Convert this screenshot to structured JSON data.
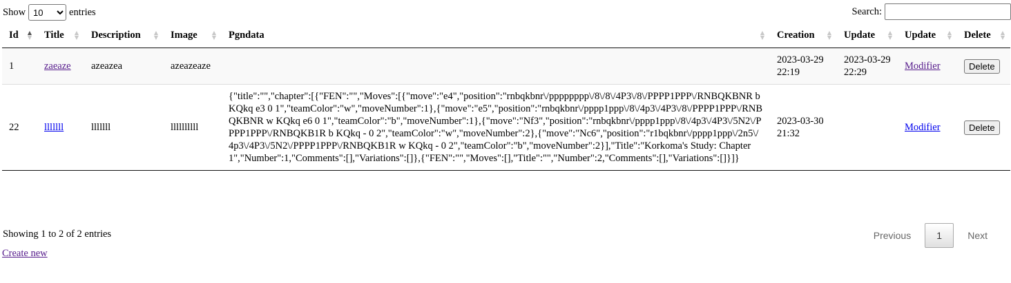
{
  "length": {
    "show": "Show",
    "value": "10",
    "entries": "entries"
  },
  "search": {
    "label": "Search:",
    "value": ""
  },
  "columns": [
    "Id",
    "Title",
    "Description",
    "Image",
    "Pgndata",
    "Creation",
    "Update",
    "Update",
    "Delete"
  ],
  "rows": [
    {
      "id": "1",
      "title": "zaeaze",
      "description": "azeazea",
      "image": "azeazeaze",
      "pgndata": "",
      "creation": "2023-03-29 22:19",
      "update": "2023-03-29 22:29",
      "modify": "Modifier",
      "delete": "Delete"
    },
    {
      "id": "22",
      "title": "lllllll",
      "description": "lllllll",
      "image": "llllllllll",
      "pgndata": "{\"title\":\"\",\"chapter\":[{\"FEN\":\"\",\"Moves\":[{\"move\":\"e4\",\"position\":\"rnbqkbnr\\/pppppppp\\/8\\/8\\/4P3\\/8\\/PPPP1PPP\\/RNBQKBNR b KQkq e3 0 1\",\"teamColor\":\"w\",\"moveNumber\":1},{\"move\":\"e5\",\"position\":\"rnbqkbnr\\/pppp1ppp\\/8\\/4p3\\/4P3\\/8\\/PPPP1PPP\\/RNBQKBNR w KQkq e6 0 1\",\"teamColor\":\"b\",\"moveNumber\":1},{\"move\":\"Nf3\",\"position\":\"rnbqkbnr\\/pppp1ppp\\/8\\/4p3\\/4P3\\/5N2\\/PPPP1PPP\\/RNBQKB1R b KQkq - 0 2\",\"teamColor\":\"w\",\"moveNumber\":2},{\"move\":\"Nc6\",\"position\":\"r1bqkbnr\\/pppp1ppp\\/2n5\\/4p3\\/4P3\\/5N2\\/PPPP1PPP\\/RNBQKB1R w KQkq - 0 2\",\"teamColor\":\"b\",\"moveNumber\":2}],\"Title\":\"Korkoma's Study: Chapter 1\",\"Number\":1,\"Comments\":[],\"Variations\":[]},{\"FEN\":\"\",\"Moves\":[],\"Title\":\"\",\"Number\":2,\"Comments\":[],\"Variations\":[]}]}",
      "creation": "2023-03-30 21:32",
      "update": "",
      "modify": "Modifier",
      "delete": "Delete"
    }
  ],
  "info": "Showing 1 to 2 of 2 entries",
  "pagination": {
    "previous": "Previous",
    "current": "1",
    "next": "Next"
  },
  "create_link": "Create new"
}
